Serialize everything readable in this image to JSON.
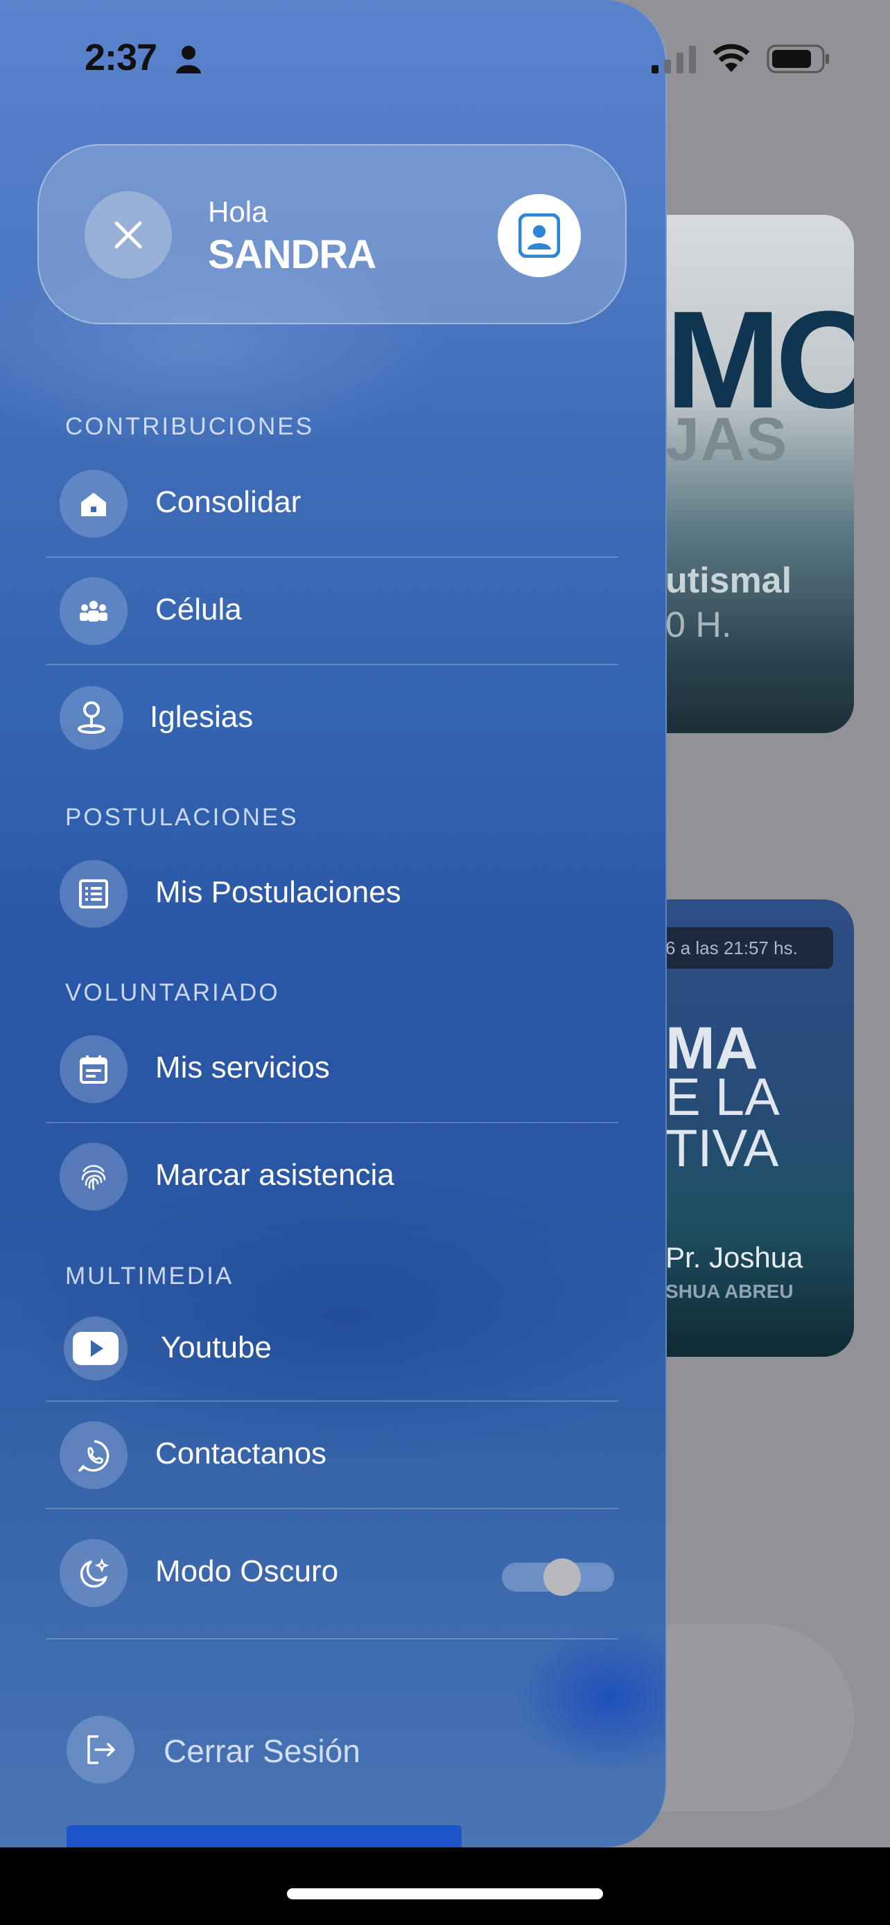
{
  "status_bar": {
    "time": "2:37"
  },
  "header": {
    "greeting": "Hola",
    "user_name": "SANDRA"
  },
  "background": {
    "card1": {
      "big": "MO",
      "sub": "JAS",
      "line1": "utismal",
      "line2": "0 H."
    },
    "card2": {
      "pill": "6 a las 21:57 hs.",
      "line1": "MA",
      "line2": "E LA",
      "line3": "TIVA",
      "line4": "Pr. Joshua",
      "line5": "SHUA ABREU"
    }
  },
  "sections": {
    "contribuciones": "CONTRIBUCIONES",
    "postulaciones": "POSTULACIONES",
    "voluntariado": "VOLUNTARIADO",
    "multimedia": "MULTIMEDIA"
  },
  "menu": {
    "consolidar": {
      "label": "Consolidar",
      "icon": "home-icon"
    },
    "celula": {
      "label": "Célula",
      "icon": "group-icon"
    },
    "iglesias": {
      "label": "Iglesias",
      "icon": "location-pin-icon"
    },
    "mis_postulaciones": {
      "label": "Mis Postulaciones",
      "icon": "list-icon"
    },
    "mis_servicios": {
      "label": "Mis servicios",
      "icon": "calendar-icon"
    },
    "marcar_asistencia": {
      "label": "Marcar asistencia",
      "icon": "fingerprint-icon"
    },
    "youtube": {
      "label": "Youtube",
      "icon": "youtube-icon"
    },
    "contactanos": {
      "label": "Contactanos",
      "icon": "whatsapp-icon"
    },
    "modo_oscuro": {
      "label": "Modo Oscuro",
      "icon": "moon-icon",
      "enabled": false
    }
  },
  "logout": {
    "label": "Cerrar Sesión",
    "icon": "logout-icon"
  },
  "colors": {
    "drawer_top": "#5a83cc",
    "drawer_mid": "#2956a6",
    "accent": "#2f86d6"
  }
}
